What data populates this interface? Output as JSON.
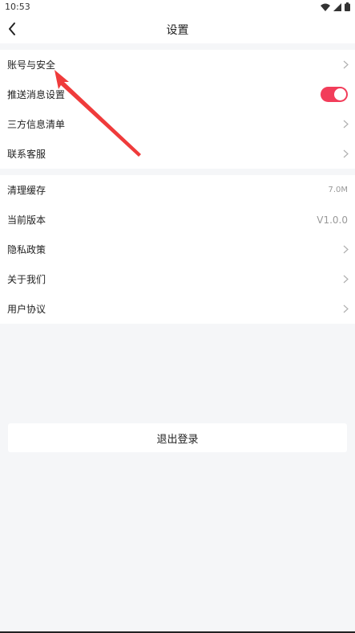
{
  "status_bar": {
    "time": "10:53"
  },
  "header": {
    "title": "设置"
  },
  "group1": [
    {
      "label": "账号与安全",
      "type": "link"
    },
    {
      "label": "推送消息设置",
      "type": "toggle",
      "enabled": true
    },
    {
      "label": "三方信息清单",
      "type": "link"
    },
    {
      "label": "联系客服",
      "type": "link"
    }
  ],
  "group2": [
    {
      "label": "清理缓存",
      "value": "7.0M"
    },
    {
      "label": "当前版本",
      "value": "V1.0.0"
    },
    {
      "label": "隐私政策"
    },
    {
      "label": "关于我们"
    },
    {
      "label": "用户协议"
    }
  ],
  "logout_label": "退出登录",
  "colors": {
    "accent": "#f23d5a",
    "annotation_arrow": "#ef3b3b"
  }
}
